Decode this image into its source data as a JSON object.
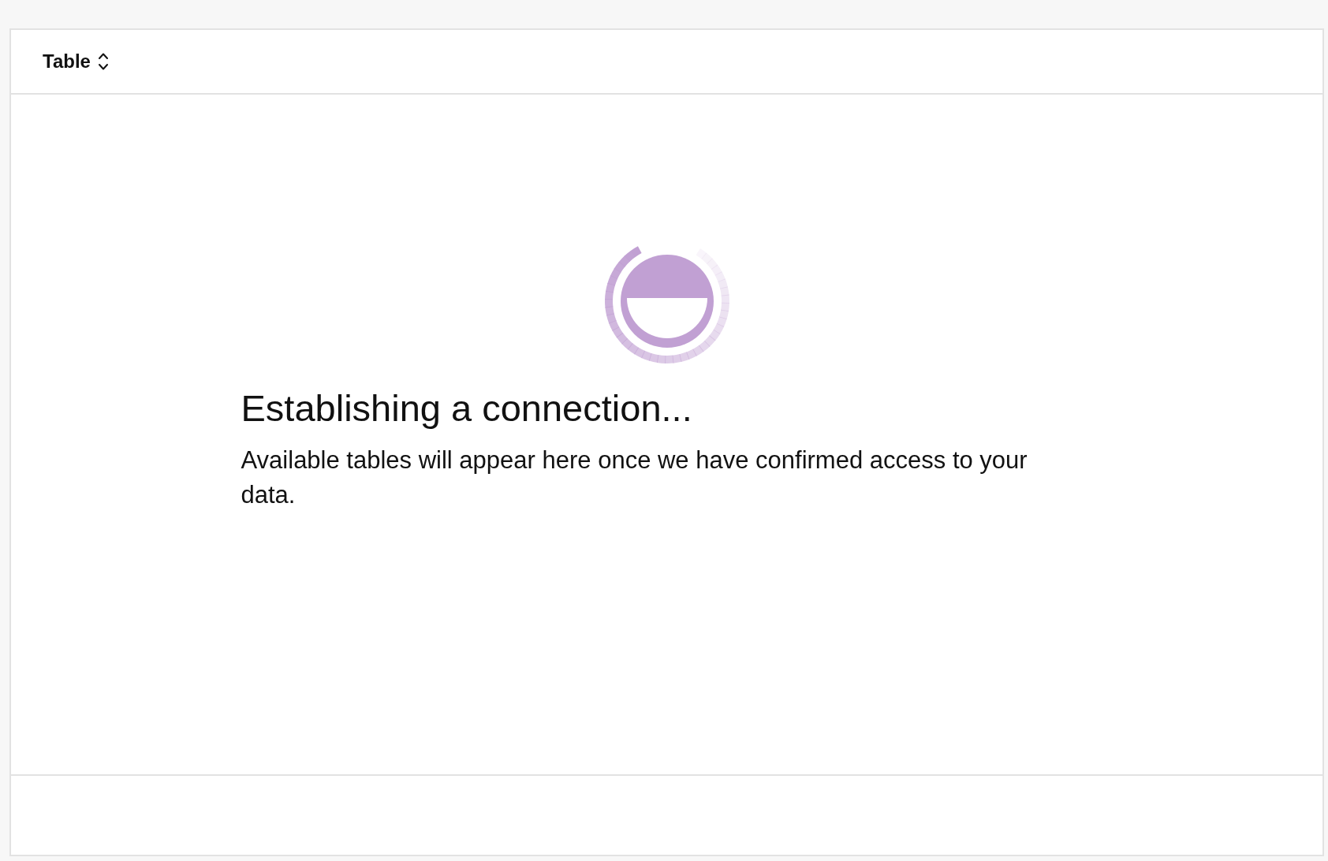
{
  "header": {
    "table_selector": {
      "label": "Table"
    }
  },
  "empty_state": {
    "title": "Establishing a connection...",
    "message": "Available tables will appear here once we have confirmed access to your data."
  }
}
